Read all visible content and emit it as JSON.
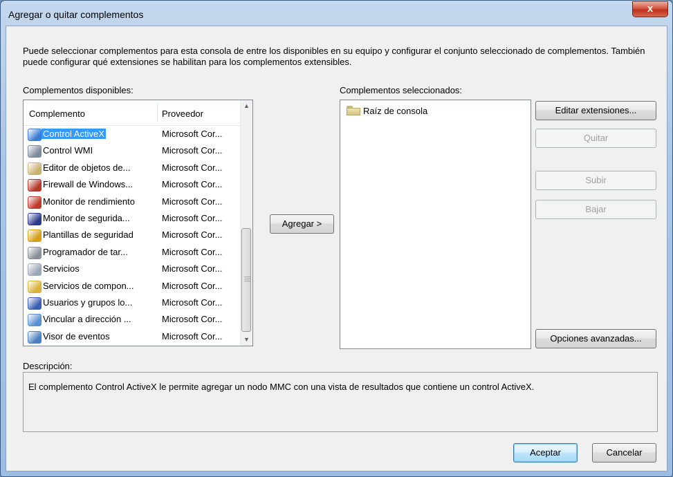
{
  "window": {
    "title": "Agregar o quitar complementos",
    "close_label": "x"
  },
  "intro": "Puede seleccionar complementos para esta consola de entre los disponibles en su equipo y configurar el conjunto seleccionado de complementos. También puede configurar qué extensiones se habilitan para los complementos extensibles.",
  "available": {
    "label": "Complementos disponibles:",
    "columns": [
      "Complemento",
      "Proveedor"
    ],
    "items": [
      {
        "name": "Control ActiveX",
        "provider": "Microsoft Cor...",
        "icon": "activex-plug-icon",
        "color": "#3a7bd5"
      },
      {
        "name": "Control WMI",
        "provider": "Microsoft Cor...",
        "icon": "computer-icon",
        "color": "#7d8a99"
      },
      {
        "name": "Editor de objetos de...",
        "provider": "Microsoft Cor...",
        "icon": "policy-document-icon",
        "color": "#c9b270"
      },
      {
        "name": "Firewall de Windows...",
        "provider": "Microsoft Cor...",
        "icon": "firewall-icon",
        "color": "#b23a2a"
      },
      {
        "name": "Monitor de rendimiento",
        "provider": "Microsoft Cor...",
        "icon": "performance-gauge-icon",
        "color": "#c0392b"
      },
      {
        "name": "Monitor de segurida...",
        "provider": "Microsoft Cor...",
        "icon": "security-monitor-icon",
        "color": "#2b3a8a"
      },
      {
        "name": "Plantillas de seguridad",
        "provider": "Microsoft Cor...",
        "icon": "security-template-icon",
        "color": "#d4a017"
      },
      {
        "name": "Programador de tar...",
        "provider": "Microsoft Cor...",
        "icon": "clock-icon",
        "color": "#8a8f99"
      },
      {
        "name": "Servicios",
        "provider": "Microsoft Cor...",
        "icon": "gears-icon",
        "color": "#9aa7b8"
      },
      {
        "name": "Servicios de compon...",
        "provider": "Microsoft Cor...",
        "icon": "component-services-icon",
        "color": "#d8b23a"
      },
      {
        "name": "Usuarios y grupos lo...",
        "provider": "Microsoft Cor...",
        "icon": "users-icon",
        "color": "#3b5fb0"
      },
      {
        "name": "Vincular a dirección ...",
        "provider": "Microsoft Cor...",
        "icon": "web-link-icon",
        "color": "#5a8fd0"
      },
      {
        "name": "Visor de eventos",
        "provider": "Microsoft Cor...",
        "icon": "event-viewer-icon",
        "color": "#4a7fc0"
      }
    ],
    "selected_index": 0
  },
  "add_button": "Agregar >",
  "selected": {
    "label": "Complementos seleccionados:",
    "items": [
      {
        "name": "Raíz de consola",
        "icon": "folder-icon"
      }
    ]
  },
  "side_buttons": {
    "edit_extensions": "Editar extensiones...",
    "remove": "Quitar",
    "move_up": "Subir",
    "move_down": "Bajar",
    "advanced": "Opciones avanzadas..."
  },
  "description": {
    "label": "Descripción:",
    "text": "El complemento Control ActiveX le permite agregar un nodo MMC con una vista de resultados que contiene un control ActiveX."
  },
  "footer": {
    "ok": "Aceptar",
    "cancel": "Cancelar"
  }
}
